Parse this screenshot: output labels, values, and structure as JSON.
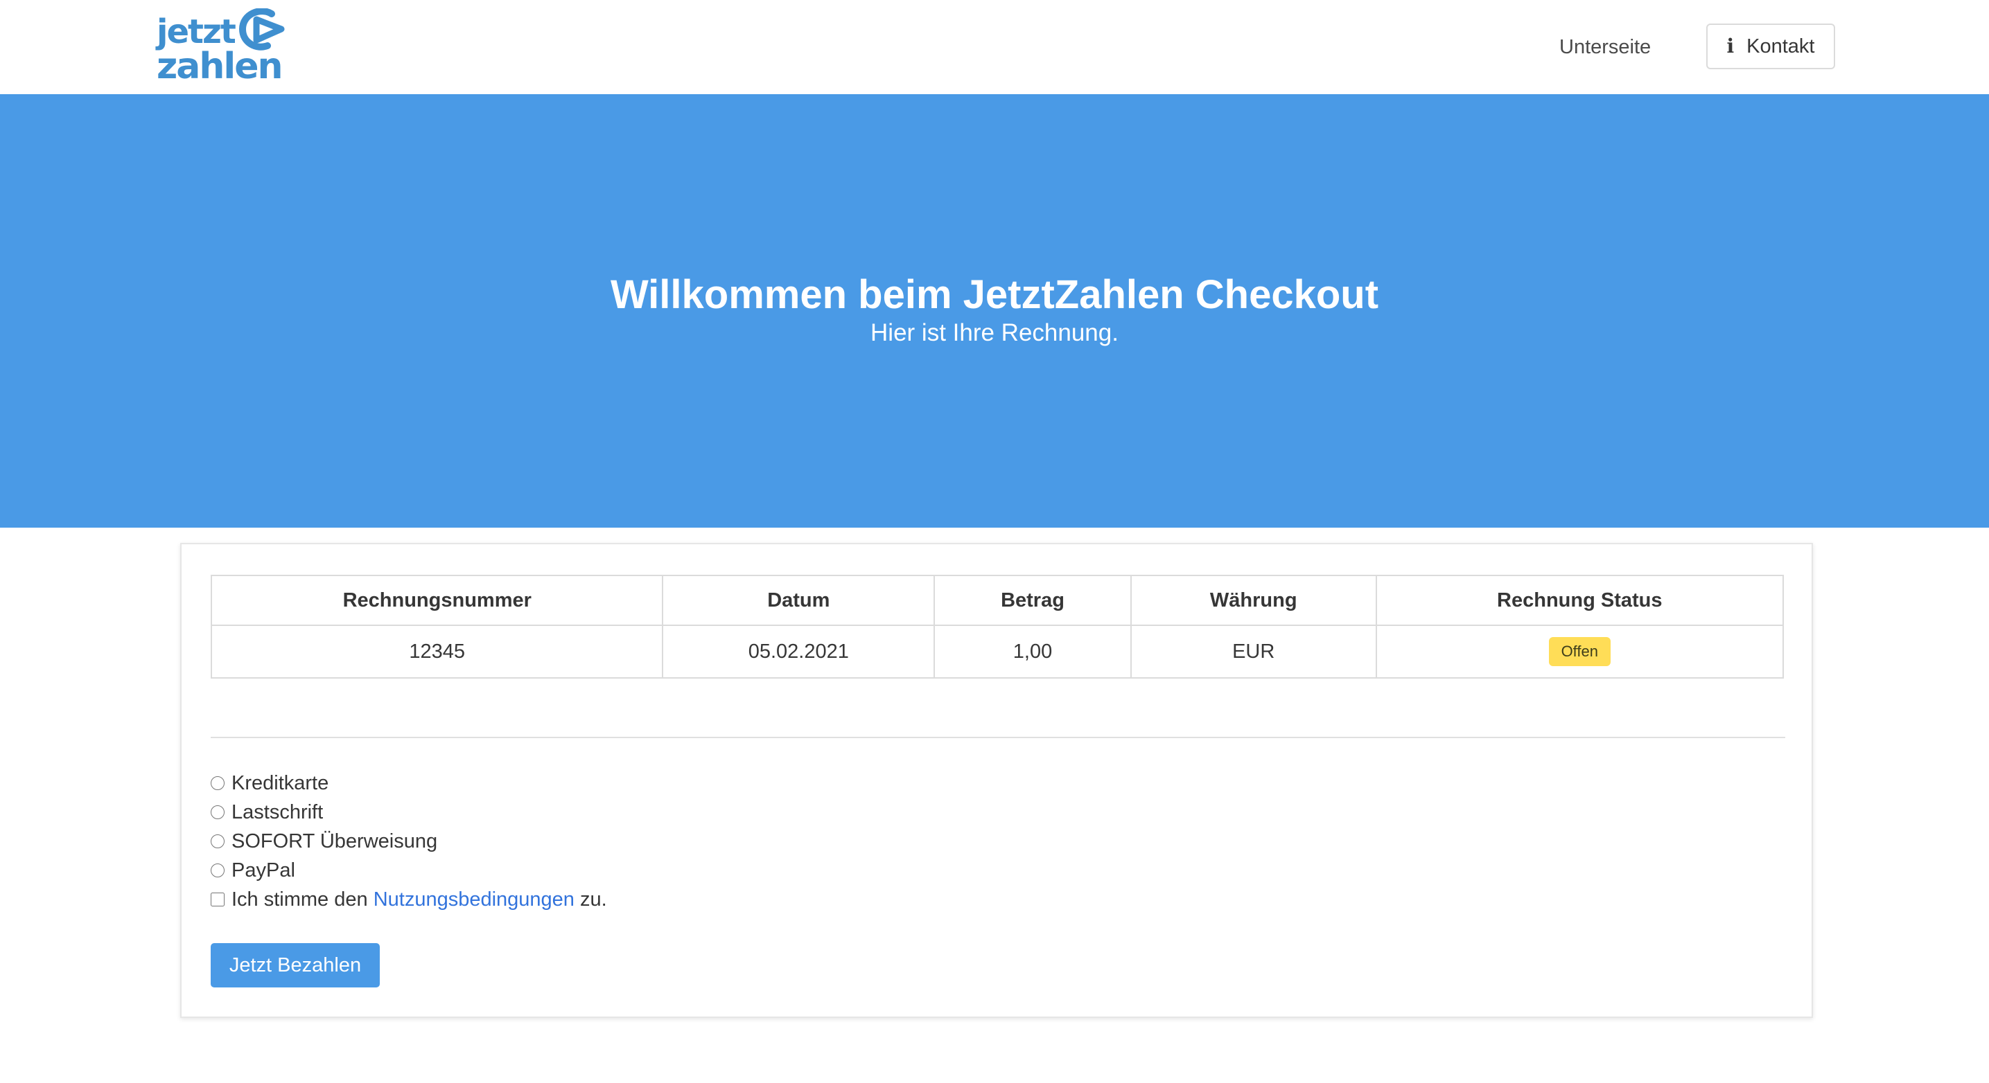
{
  "brand": {
    "logo_line1": "jetzt",
    "logo_line2": "zahlen",
    "color": "#3f8fcf"
  },
  "nav": {
    "link_label": "Unterseite",
    "contact_label": "Kontakt",
    "contact_icon": "info-icon"
  },
  "hero": {
    "title": "Willkommen beim JetztZahlen Checkout",
    "subtitle": "Hier ist Ihre Rechnung.",
    "background": "#4a9ae6"
  },
  "invoice_table": {
    "headers": [
      "Rechnungsnummer",
      "Datum",
      "Betrag",
      "Währung",
      "Rechnung Status"
    ],
    "row": {
      "number": "12345",
      "date": "05.02.2021",
      "amount": "1,00",
      "currency": "EUR",
      "status": "Offen"
    },
    "status_color": "#ffdd57"
  },
  "payment": {
    "methods": [
      "Kreditkarte",
      "Lastschrift",
      "SOFORT Überweisung",
      "PayPal"
    ],
    "terms_prefix": "Ich stimme den ",
    "terms_link": "Nutzungsbedingungen",
    "terms_suffix": " zu.",
    "submit_label": "Jetzt Bezahlen",
    "link_color": "#3273dc"
  }
}
